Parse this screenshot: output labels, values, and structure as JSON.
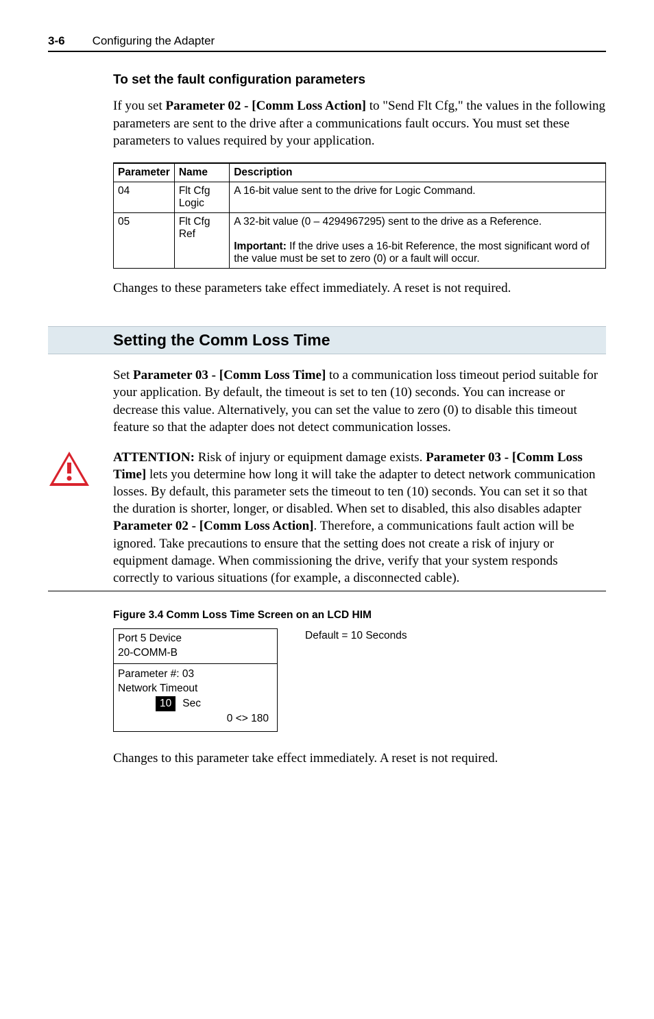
{
  "header": {
    "page_number": "3-6",
    "chapter_title": "Configuring the Adapter"
  },
  "fault_cfg": {
    "heading": "To set the fault configuration parameters",
    "intro_before_bold": "If you set ",
    "param_bold": "Parameter 02 - [Comm Loss Action]",
    "intro_after_bold": " to \"Send Flt Cfg,\" the values in the following parameters are sent to the drive after a communications fault occurs. You must set these parameters to values required by your application.",
    "table": {
      "headers": {
        "c1": "Parameter",
        "c2": "Name",
        "c3": "Description"
      },
      "rows": [
        {
          "c1": "04",
          "c2": "Flt Cfg Logic",
          "c3": "A 16-bit value sent to the drive for Logic Command."
        },
        {
          "c1": "05",
          "c2": "Flt Cfg Ref",
          "c3_line1": "A 32-bit value (0 – 4294967295) sent to the drive as a Reference.",
          "c3_important_label": "Important:",
          "c3_important_text": " If the drive uses a 16-bit Reference, the most significant word of the value must be set to zero (0) or a fault will occur."
        }
      ]
    },
    "outro": "Changes to these parameters take effect immediately. A reset is not required."
  },
  "comm_loss": {
    "heading": "Setting the Comm Loss Time",
    "p1_before": "Set ",
    "p1_bold": "Parameter 03 - [Comm Loss Time]",
    "p1_after": " to a communication loss timeout period suitable for your application. By default, the timeout is set to ten (10) seconds. You can increase or decrease this value. Alternatively, you can set the value to zero (0) to disable this timeout feature so that the adapter does not detect communication losses.",
    "attention": {
      "label": "ATTENTION:",
      "t1": "  Risk of injury or equipment damage exists. ",
      "b1": "Parameter 03 - [Comm Loss Time]",
      "t2": " lets you determine how long it will take the adapter to detect network communication losses. By default, this parameter sets the timeout to ten (10) seconds. You can set it so that the duration is shorter, longer, or disabled. When set to disabled, this also disables adapter ",
      "b2": "Parameter 02 - [Comm Loss Action]",
      "t3": ". Therefore, a communications fault action will be ignored. Take precautions to ensure that the setting does not create a risk of injury or equipment damage. When commissioning the drive, verify that your system responds correctly to various situations (for example, a disconnected cable)."
    },
    "figure_caption": "Figure 3.4   Comm Loss Time Screen on an LCD HIM",
    "lcd": {
      "line1": "Port 5 Device",
      "line2": "20-COMM-B",
      "line3": "Parameter #: 03",
      "line4": "Network Timeout",
      "value": "10",
      "unit": "Sec",
      "range": "0 <> 180",
      "side_note": "Default = 10 Seconds"
    },
    "outro": "Changes to this parameter take effect immediately. A reset is not required."
  }
}
